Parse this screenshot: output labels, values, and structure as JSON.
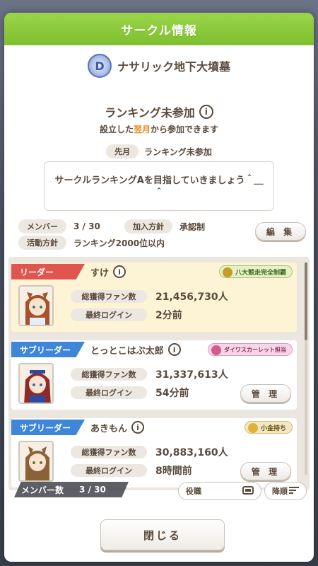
{
  "dialog": {
    "title": "サークル情報",
    "close_label": "閉じる"
  },
  "circle": {
    "emblem_letter": "D",
    "name": "ナサリック地下大墳墓"
  },
  "ranking": {
    "title": "ランキング未参加",
    "notice_prefix": "設立した",
    "notice_highlight": "翌月",
    "notice_suffix": "から参加できます",
    "last_month_label": "先月",
    "last_month_value": "ランキング未参加"
  },
  "message": "サークルランキングAを目指していきましょう＾＿＾",
  "meta": {
    "members_label": "メンバー",
    "members_value": "3 / 30",
    "join_policy_label": "加入方針",
    "join_policy_value": "承認制",
    "activity_label": "活動方針",
    "activity_value": "ランキング2000位以内",
    "edit_label": "編 集"
  },
  "members": [
    {
      "role": "リーダー",
      "name": "すけ",
      "badge": "八大競走完全制覇",
      "fans_label": "総獲得ファン数",
      "fans_value": "21,456,730人",
      "login_label": "最終ログイン",
      "login_value": "2分前"
    },
    {
      "role": "サブリーダー",
      "name": "とっとこはぶ太郎",
      "badge": "ダイワスカーレット担当",
      "fans_label": "総獲得ファン数",
      "fans_value": "31,337,613人",
      "login_label": "最終ログイン",
      "login_value": "54分前",
      "manage_label": "管 理"
    },
    {
      "role": "サブリーダー",
      "name": "あきもん",
      "badge": "小金持ち",
      "fans_label": "総獲得ファン数",
      "fans_value": "30,883,160人",
      "login_label": "最終ログイン",
      "login_value": "8時間前",
      "manage_label": "管 理"
    }
  ],
  "footer": {
    "member_count_label": "メンバー数",
    "member_count_value": "3 / 30",
    "sort_role_label": "役職",
    "sort_order_label": "降順"
  },
  "colors": {
    "header_green": "#86c736",
    "leader_red": "#e0554e",
    "subleader_blue": "#3d86d8",
    "highlight_orange": "#e88a1e",
    "text_brown": "#5a4a3c"
  },
  "icons": [
    "info-icon",
    "emblem-icon",
    "badge-icon",
    "sort-icon",
    "filter-icon"
  ]
}
